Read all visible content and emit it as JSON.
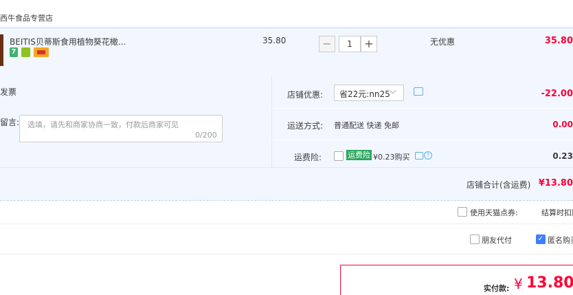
{
  "store": {
    "name": "西牛食品专营店"
  },
  "item": {
    "title": "BEITIS贝蒂斯食用植物葵花橄...",
    "badge_7": "7",
    "unit_price": "35.80",
    "quantity": "1",
    "discount_text": "无优惠",
    "total": "35.80"
  },
  "order": {
    "invoice_label": "发票",
    "message_label": "留言:",
    "message_placeholder": "选填，请先和商家协商一致，付款后商家可见",
    "message_count": "0/200",
    "store_discount_label": "店铺优惠:",
    "store_discount_value": "省22元:nn25",
    "store_discount_amount": "-22.00",
    "shipping_label": "运送方式:",
    "shipping_value": "普通配送 快递 免邮",
    "shipping_amount": "0.00",
    "insurance_label": "运费险:",
    "insurance_tag": "运费险",
    "insurance_price": "¥0.23购买",
    "insurance_amount": "0.23",
    "subtotal_label": "店铺合计(含运费)",
    "subtotal_amount": "¥13.80"
  },
  "options": {
    "tmall_coupon_label": "使用天猫点券:",
    "tmall_coupon_hint": "结算时扣除",
    "friend_pay_label": "朋友代付",
    "anonymous_label": "匿名购买",
    "anonymous_checked": true
  },
  "payment": {
    "label": "实付款:",
    "currency": "¥",
    "amount": "13.80"
  },
  "colors": {
    "accent": "#ff0036",
    "row_bg": "#f2f7ff",
    "link": "#3d7eff"
  }
}
